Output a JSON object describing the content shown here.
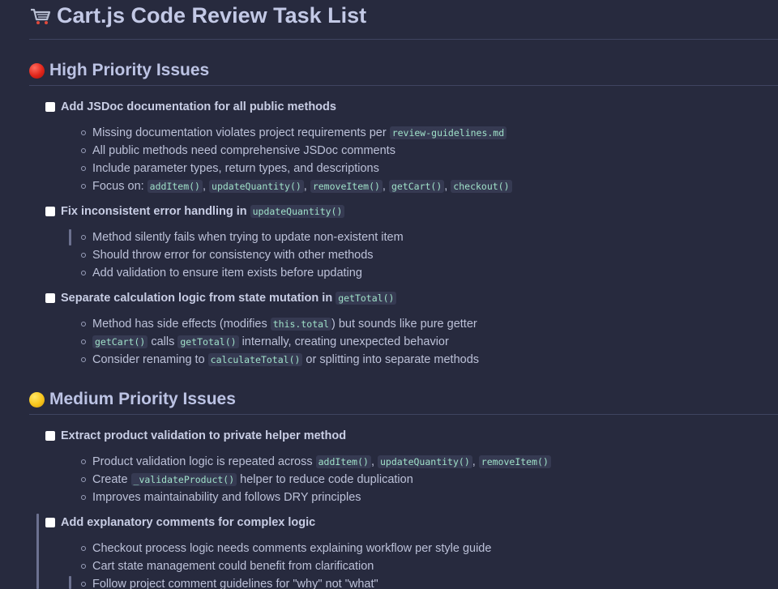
{
  "title": "Cart.js Code Review Task List",
  "title_icon": "shopping-cart-icon",
  "sections": [
    {
      "heading": "High Priority Issues",
      "icon": "red-circle-icon",
      "color": "#e0251a",
      "tasks": [
        {
          "label": "Add JSDoc documentation for all public methods",
          "code": "",
          "bullets": [
            {
              "text": "Missing documentation violates project requirements per",
              "code": [
                "review-guidelines.md"
              ],
              "after": ""
            },
            {
              "text": "All public methods need comprehensive JSDoc comments"
            },
            {
              "text": "Include parameter types, return types, and descriptions"
            },
            {
              "text": "Focus on:",
              "code": [
                "addItem()",
                "updateQuantity()",
                "removeItem()",
                "getCart()",
                "checkout()"
              ]
            }
          ]
        },
        {
          "label": "Fix inconsistent error handling in",
          "code": "updateQuantity()",
          "bullets": [
            {
              "text": "Method silently fails when trying to update non-existent item"
            },
            {
              "text": "Should throw error for consistency with other methods"
            },
            {
              "text": "Add validation to ensure item exists before updating"
            }
          ]
        },
        {
          "label": "Separate calculation logic from state mutation in",
          "code": "getTotal()",
          "bullets": [
            {
              "before": "Method has side effects (modifies",
              "code": "this.total",
              "after": ") but sounds like pure getter"
            },
            {
              "code1": "getCart()",
              "mid": "calls",
              "code2": "getTotal()",
              "after": "internally, creating unexpected behavior"
            },
            {
              "before": "Consider renaming to",
              "code": "calculateTotal()",
              "after": "or splitting into separate methods"
            }
          ]
        }
      ]
    },
    {
      "heading": "Medium Priority Issues",
      "icon": "yellow-circle-icon",
      "color": "#f7c51c",
      "tasks": [
        {
          "label": "Extract product validation to private helper method",
          "code": "",
          "bullets": [
            {
              "text": "Product validation logic is repeated across",
              "code": [
                "addItem()",
                "updateQuantity()",
                "removeItem()"
              ]
            },
            {
              "before": "Create",
              "code": "_validateProduct()",
              "after": "helper to reduce code duplication"
            },
            {
              "text": "Improves maintainability and follows DRY principles"
            }
          ]
        },
        {
          "label": "Add explanatory comments for complex logic",
          "code": "",
          "bullets": [
            {
              "text": "Checkout process logic needs comments explaining workflow per style guide"
            },
            {
              "text": "Cart state management could benefit from clarification"
            },
            {
              "text": "Follow project comment guidelines for \"why\" not \"what\""
            }
          ]
        }
      ]
    }
  ]
}
